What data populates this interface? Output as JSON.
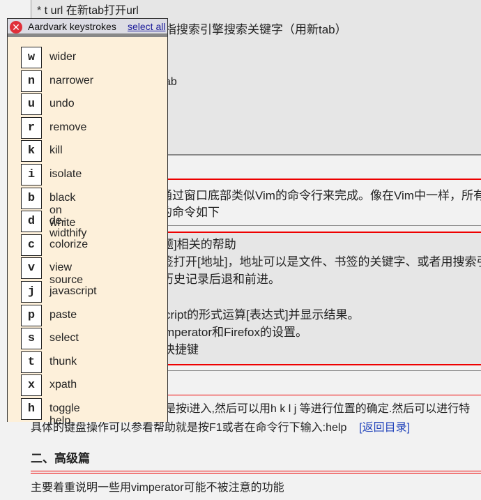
{
  "background": {
    "line1": "* t url 在新tab打开url",
    "line2": "指搜索引擎搜索关键字（用新tab）",
    "line3": "ab",
    "line4": "通过窗口底部类似Vim的命令行来完成。像在Vim中一样，所有",
    "line5": "的命令如下",
    "cmd1": "题]相关的帮助",
    "cmd2": "签打开[地址]，地址可以是文件、书签的关键字、或者用搜索引",
    "cmd3": "历史记录后退和前进。",
    "cmd4": "。",
    "cmd5": "cript的形式运算[表达式]并显示结果。",
    "cmd6": "mperator和Firefox的设置。",
    "cmd7": "快捷键",
    "para1": "是按i进入,然后可以用h k l j 等进行位置的确定.然后可以进行特",
    "para2": "具体的键盘操作可以参看帮助就是按F1或者在命令行下输入:help",
    "back_link": "[返回目录]",
    "heading": "二、高级篇",
    "para3": "主要着重说明一些用vimperator可能不被注意的功能"
  },
  "popup": {
    "title": "Aardvark keystrokes",
    "select_all": "select all",
    "close_icon": "close-icon",
    "items": [
      {
        "key": "w",
        "label": "wider"
      },
      {
        "key": "n",
        "label": "narrower"
      },
      {
        "key": "u",
        "label": "undo"
      },
      {
        "key": "r",
        "label": "remove"
      },
      {
        "key": "k",
        "label": "kill"
      },
      {
        "key": "i",
        "label": "isolate"
      },
      {
        "key": "b",
        "label": "black on white"
      },
      {
        "key": "d",
        "label": "de-widthify"
      },
      {
        "key": "c",
        "label": "colorize"
      },
      {
        "key": "v",
        "label": "view source"
      },
      {
        "key": "j",
        "label": "javascript"
      },
      {
        "key": "p",
        "label": "paste"
      },
      {
        "key": "s",
        "label": "select"
      },
      {
        "key": "t",
        "label": "thunk"
      },
      {
        "key": "x",
        "label": "xpath"
      },
      {
        "key": "h",
        "label": "toggle help"
      }
    ]
  }
}
